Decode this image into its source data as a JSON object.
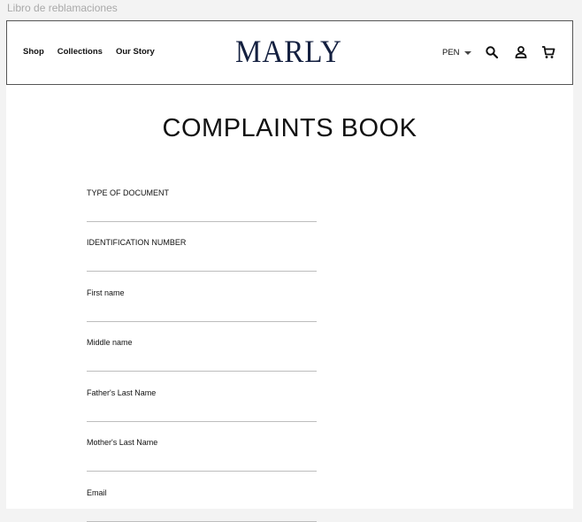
{
  "window": {
    "label": "Libro de reblamaciones"
  },
  "header": {
    "nav": [
      "Shop",
      "Collections",
      "Our Story"
    ],
    "logo": "MARLY",
    "currency": "PEN",
    "icons": [
      "search-icon",
      "user-icon",
      "cart-icon"
    ]
  },
  "main": {
    "title": "COMPLAINTS BOOK",
    "fields": [
      {
        "label": "TYPE OF DOCUMENT",
        "value": ""
      },
      {
        "label": "IDENTIFICATION NUMBER",
        "value": ""
      },
      {
        "label": "First name",
        "value": ""
      },
      {
        "label": "Middle name",
        "value": ""
      },
      {
        "label": "Father's Last Name",
        "value": ""
      },
      {
        "label": "Mother's Last Name",
        "value": ""
      },
      {
        "label": "Email",
        "value": ""
      }
    ]
  },
  "colors": {
    "logo": "#142040",
    "field_underline": "#bdbdbd",
    "page_background": "#f3f3f3"
  }
}
